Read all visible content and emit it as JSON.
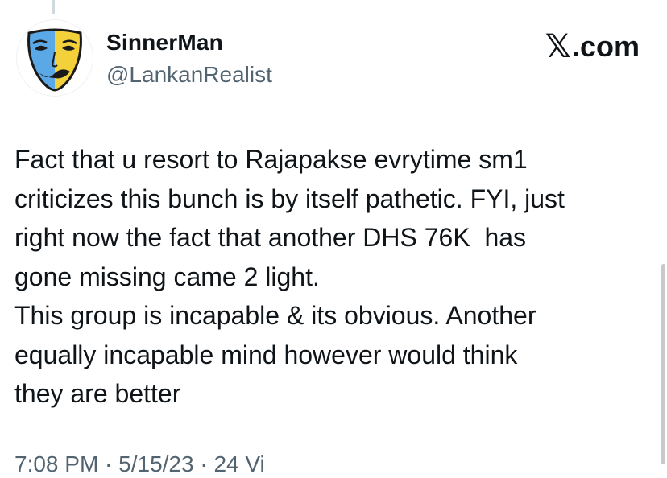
{
  "tweet": {
    "author": {
      "display_name": "SinnerMan",
      "handle": "@LankanRealist",
      "avatar_icon": "comedy-tragedy-mask-icon"
    },
    "brand": {
      "icon": "x-logo-icon",
      "suffix": ".com"
    },
    "text_lines": [
      "Fact that u resort to Rajapakse evrytime sm1",
      "criticizes this bunch is by itself pathetic. FYI, just",
      "right now the fact that another DHS 76K  has",
      "gone missing came 2 light.",
      "This group is incapable & its obvious. Another",
      "equally incapable mind however would think",
      "they are better"
    ],
    "meta_partial": "7:08 PM · 5/15/23 · 24 Vi"
  },
  "colors": {
    "text_primary": "#0f1419",
    "text_secondary": "#536471",
    "thread_line": "#cfd9de"
  }
}
